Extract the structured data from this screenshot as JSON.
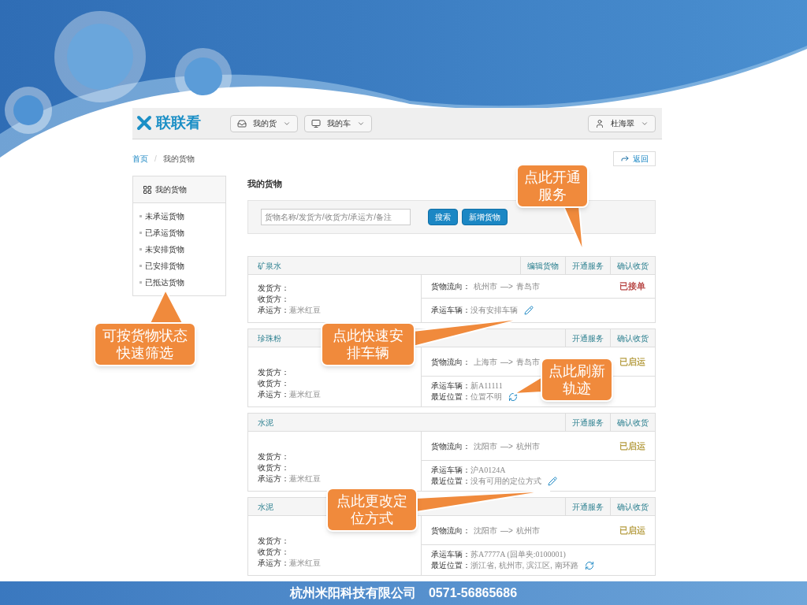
{
  "brand": {
    "name": "联联看"
  },
  "nav": [
    {
      "label": "我的货"
    },
    {
      "label": "我的车"
    }
  ],
  "user": {
    "name": "杜海翠"
  },
  "breadcrumb": [
    {
      "label": "首页"
    },
    {
      "label": "我的货物"
    }
  ],
  "breadcrumb_separator": "/",
  "back_button": "返回",
  "sidebar": {
    "title": "我的货物",
    "items": [
      "未承运货物",
      "已承运货物",
      "未安排货物",
      "已安排货物",
      "已抵达货物"
    ]
  },
  "page_title": "我的货物",
  "search": {
    "placeholder": "货物名称/发货方/收货方/承运方/备注"
  },
  "buttons": [
    "搜索",
    "新增货物"
  ],
  "cargo": [
    {
      "name": "矿泉水",
      "actions": [
        "编辑货物",
        "开通服务",
        "确认收货"
      ],
      "shipper_label": "发货方：",
      "receiver_label": "收货方：",
      "carrier_label": "承运方：",
      "carrier": "薏米红豆",
      "route_label": "货物流向：",
      "from": "杭州市",
      "arrow": "—>",
      "to": "青岛市",
      "status": "已接单",
      "color": "#b94a48",
      "vehicle_label": "承运车辆：",
      "vehicle": "没有安排车辆",
      "vehicle_editable": true
    },
    {
      "name": "珍珠粉",
      "actions": [
        "开通服务",
        "确认收货"
      ],
      "shipper_label": "发货方：",
      "receiver_label": "收货方：",
      "carrier_label": "承运方：",
      "carrier": "薏米红豆",
      "route_label": "货物流向：",
      "from": "上海市",
      "arrow": "—>",
      "to": "青岛市",
      "status": "已启运",
      "color": "#b8a048",
      "vehicle_label": "承运车辆：",
      "vehicle": "新A11111",
      "vehicle_editable": false,
      "location_label": "最近位置：",
      "location": "位置不明",
      "location_editable": false
    },
    {
      "name": "水泥",
      "actions": [
        "开通服务",
        "确认收货"
      ],
      "shipper_label": "发货方：",
      "receiver_label": "收货方：",
      "carrier_label": "承运方：",
      "carrier": "薏米红豆",
      "route_label": "货物流向：",
      "from": "沈阳市",
      "arrow": "—>",
      "to": "杭州市",
      "status": "已启运",
      "color": "#b8a048",
      "vehicle_label": "承运车辆：",
      "vehicle": "沪A0124A",
      "vehicle_editable": false,
      "location_label": "最近位置：",
      "location": "没有可用的定位方式",
      "location_editable": true
    },
    {
      "name": "水泥",
      "actions": [
        "开通服务",
        "确认收货"
      ],
      "shipper_label": "发货方：",
      "receiver_label": "收货方：",
      "carrier_label": "承运方：",
      "carrier": "薏米红豆",
      "route_label": "货物流向：",
      "from": "沈阳市",
      "arrow": "—>",
      "to": "杭州市",
      "status": "已启运",
      "color": "#b8a048",
      "vehicle_label": "承运车辆：",
      "vehicle": "苏A7777A (回单夹:0100001)",
      "vehicle_editable": false,
      "location_label": "最近位置：",
      "location": "浙江省, 杭州市, 滨江区, 南环路",
      "location_editable": false
    }
  ],
  "callouts": [
    {
      "text": "点此开通服务"
    },
    {
      "text": "可按货物状态快速筛选"
    },
    {
      "text": "点此快速安排车辆"
    },
    {
      "text": "点此刷新轨迹"
    },
    {
      "text": "点此更改定位方式"
    }
  ],
  "footer": {
    "company": "杭州米阳科技有限公司",
    "phone": "0571-56865686"
  }
}
